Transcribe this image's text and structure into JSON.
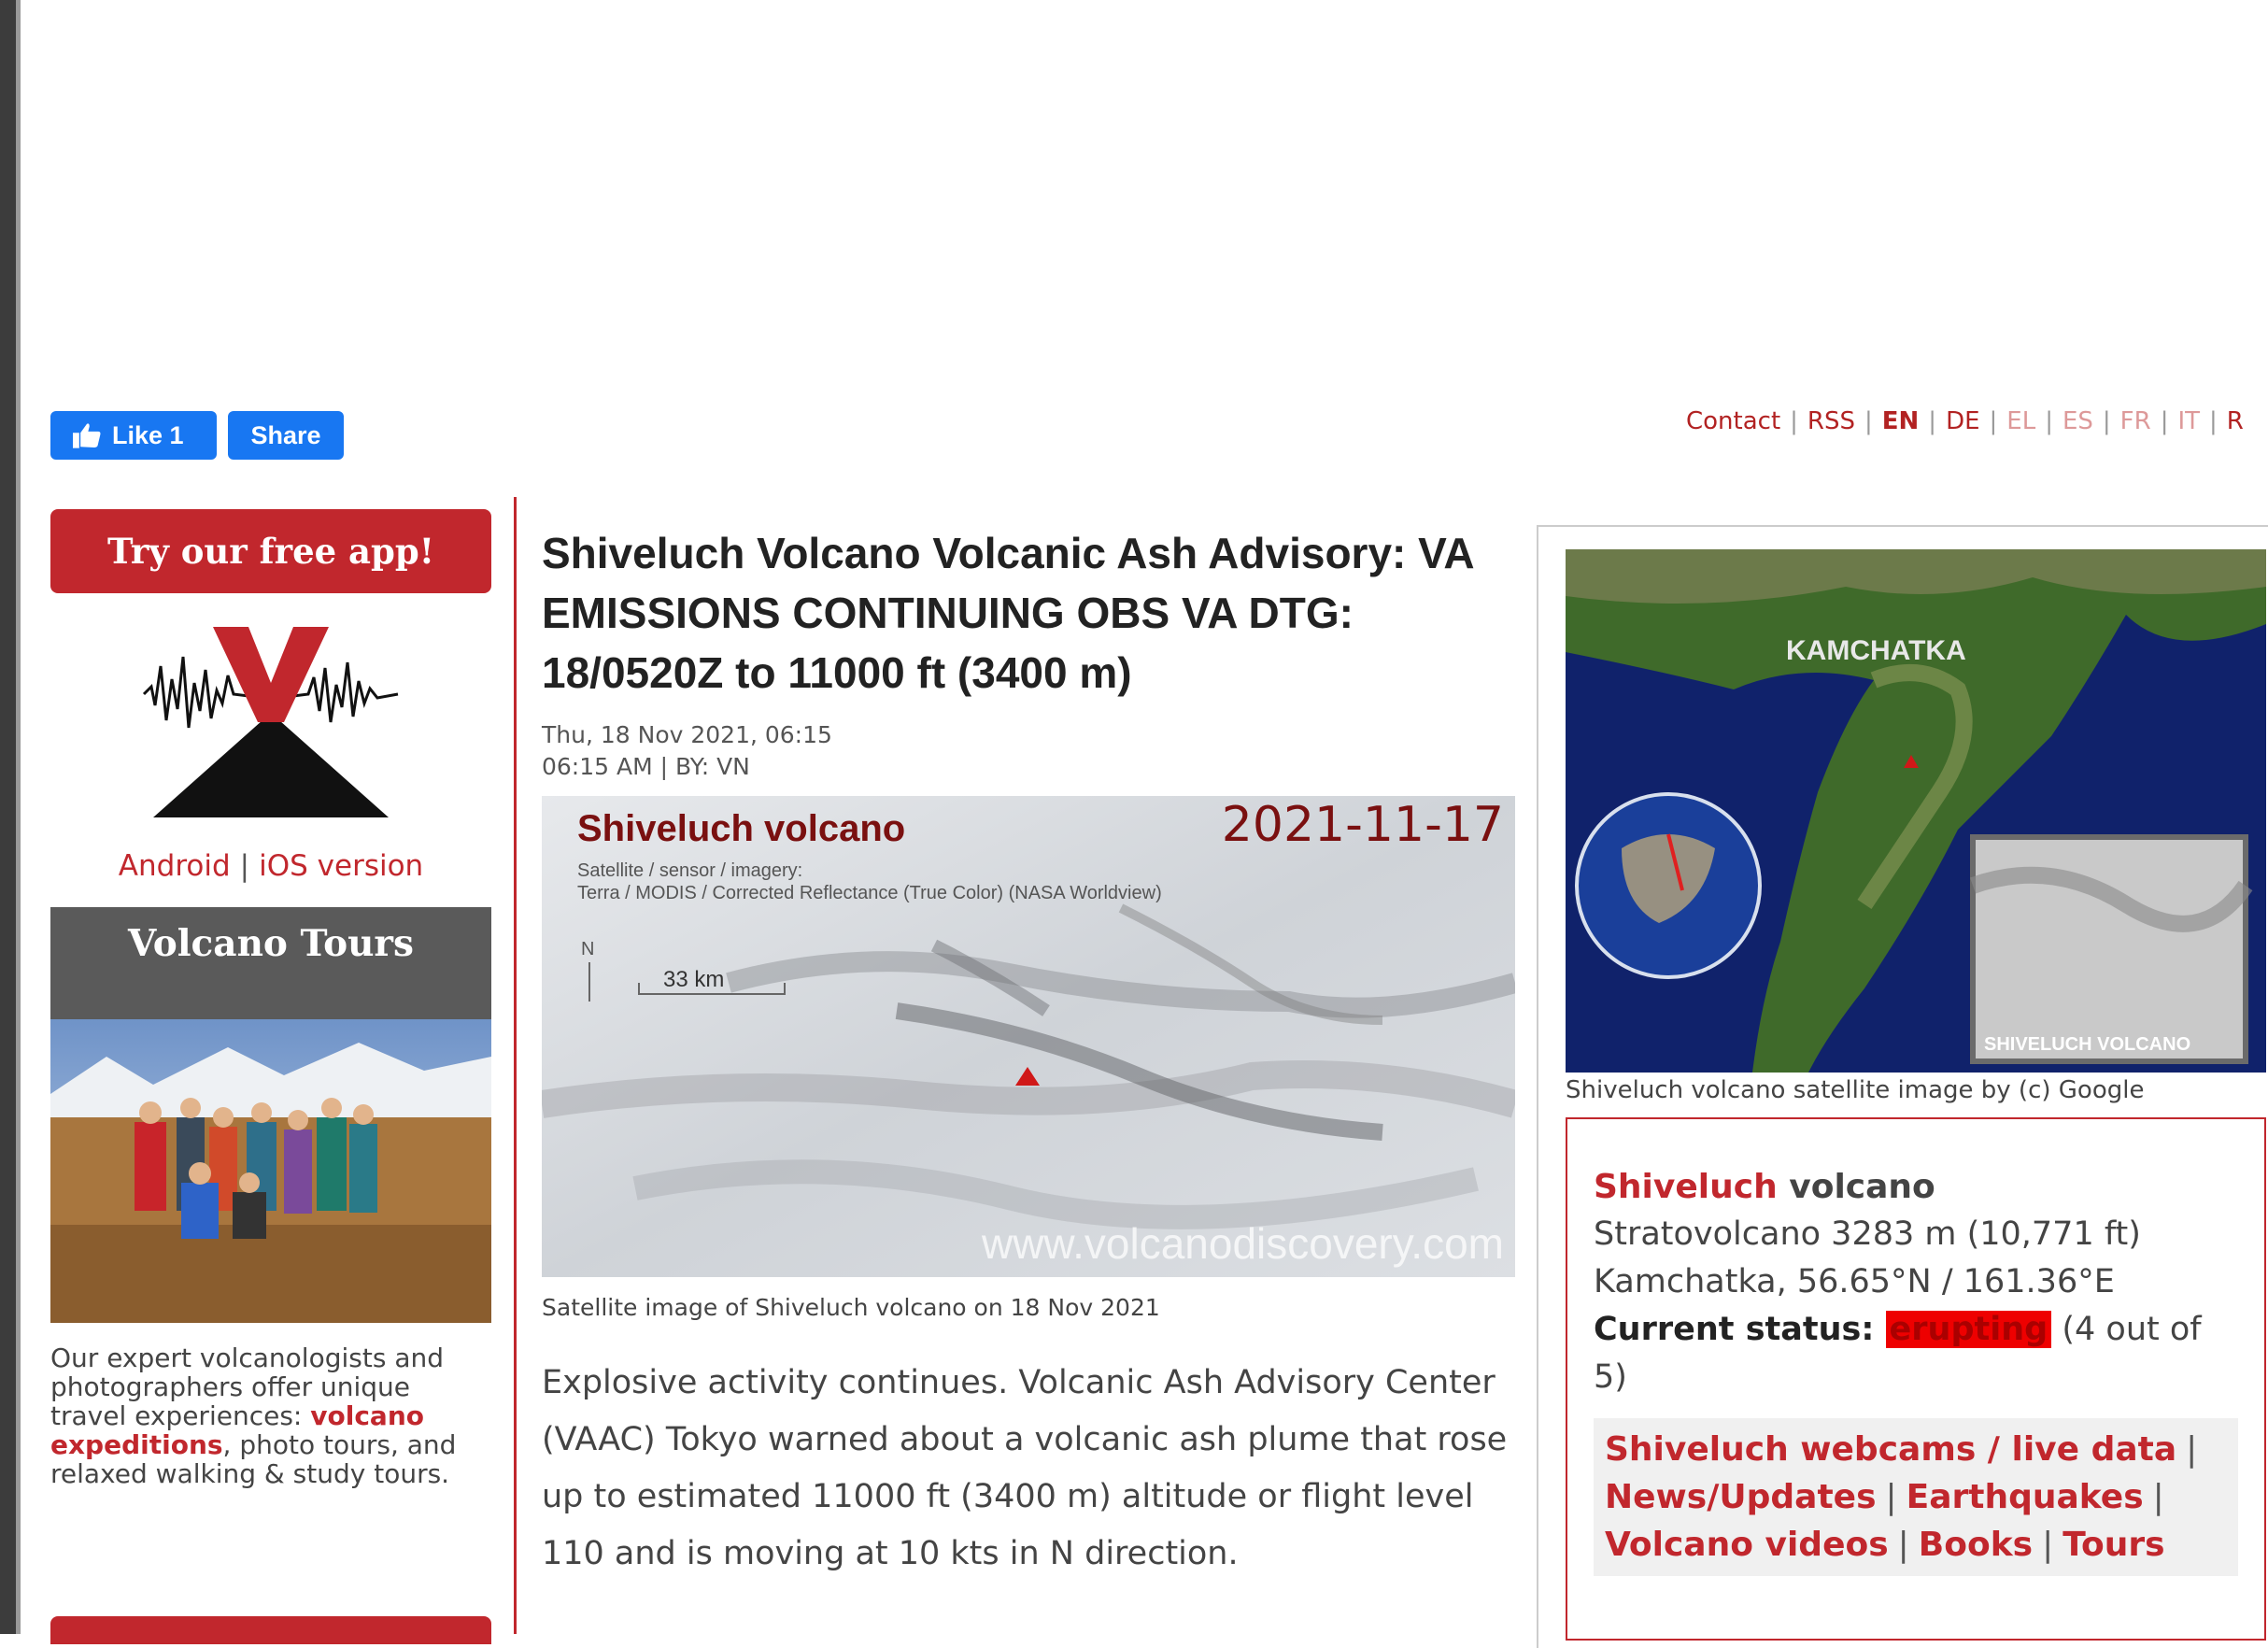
{
  "facebook": {
    "like_label": "Like 1",
    "share_label": "Share"
  },
  "lang_nav": {
    "contact": "Contact",
    "rss": "RSS",
    "en": "EN",
    "de": "DE",
    "el": "EL",
    "es": "ES",
    "fr": "FR",
    "it": "IT",
    "ru": "R"
  },
  "sidebar": {
    "app_button": "Try our free app!",
    "android": "Android",
    "ios": "iOS version",
    "tours_heading": "Volcano Tours",
    "tours_text_1": "Our expert volcanologists and photographers offer unique travel experiences: ",
    "tours_link": "volcano expeditions",
    "tours_text_2": ", photo tours, and relaxed walking & study tours."
  },
  "article": {
    "title": "Shiveluch Volcano Volcanic Ash Advisory: VA EMISSIONS CONTINUING OBS VA DTG: 18/0520Z to 11000 ft (3400 m)",
    "date_line": "Thu, 18 Nov 2021, 06:15",
    "time_by": "06:15 AM | BY: VN",
    "image_caption": "Satellite image of Shiveluch volcano on 18 Nov 2021",
    "body": "Explosive activity continues. Volcanic Ash Advisory Center (VAAC) Tokyo warned about a volcanic ash plume that rose up to estimated 11000 ft (3400 m) altitude or flight level 110 and is moving at 10 kts in N direction."
  },
  "satellite_image": {
    "title": "Shiveluch volcano",
    "date": "2021-11-17",
    "meta_1": "Satellite / sensor / imagery:",
    "meta_2": "Terra / MODIS / Corrected Reflectance (True Color) (NASA Worldview)",
    "north": "N",
    "scale": "33 km",
    "watermark": "www.volcanodiscovery.com"
  },
  "map": {
    "region_label": "KAMCHATKA",
    "inset_label": "SHIVELUCH VOLCANO",
    "caption": "Shiveluch volcano satellite image by (c) Google"
  },
  "volcano_info": {
    "name": "Shiveluch",
    "name_suffix": " volcano",
    "type_line": "Stratovolcano 3283 m (10,771 ft)",
    "location_line": "Kamchatka, 56.65°N / 161.36°E",
    "status_label": "Current status",
    "status_value": "erupting",
    "status_scale": "(4 out of 5)",
    "links": [
      "Shiveluch webcams / live data",
      "News/Updates",
      "Earthquakes",
      "Volcano videos",
      "Books",
      "Tours"
    ]
  },
  "colors": {
    "accent": "#c1272d",
    "facebook": "#1877f2",
    "status": "#ee0000"
  }
}
